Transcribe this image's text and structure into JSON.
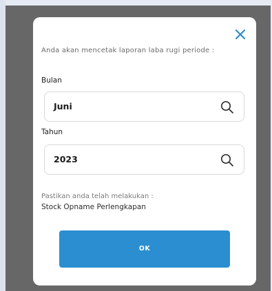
{
  "dialog": {
    "intro_text": "Anda akan mencetak laporan laba rugi periode :",
    "month": {
      "label": "Bulan",
      "value": "Juni"
    },
    "year": {
      "label": "Tahun",
      "value": "2023"
    },
    "note_label": "Pastikan anda telah melakukan :",
    "note_item": "Stock Opname Perlengkapan",
    "ok_label": "OK"
  },
  "colors": {
    "accent": "#2a8ed0",
    "overlay": "#676767",
    "background": "#e6ebf3"
  }
}
